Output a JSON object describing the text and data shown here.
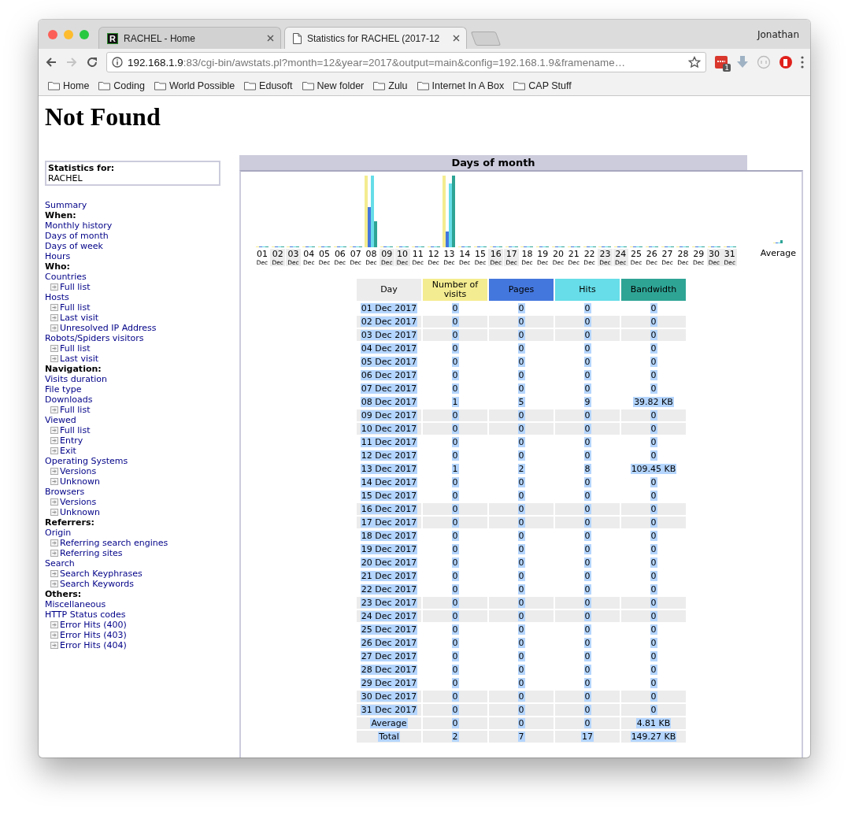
{
  "browser": {
    "tabs": [
      {
        "title": "RACHEL - Home",
        "selected": false,
        "kind": "logo",
        "logo_letter": "R"
      },
      {
        "title": "Statistics for RACHEL (2017-12",
        "selected": true,
        "kind": "page"
      }
    ],
    "profile": "Jonathan",
    "url": {
      "host": "192.168.1.9",
      "rest": ":83/cgi-bin/awstats.pl?month=12&year=2017&output=main&config=192.168.1.9&framename…"
    },
    "extension_badge": "1",
    "bookmarks": [
      "Home",
      "Coding",
      "World Possible",
      "Edusoft",
      "New folder",
      "Zulu",
      "Internet In A Box",
      "CAP Stuff"
    ]
  },
  "page": {
    "heading": "Not Found",
    "stats_for": {
      "label": "Statistics for:",
      "value": "RACHEL"
    },
    "menu": [
      {
        "kind": "link",
        "label": "Summary"
      },
      {
        "kind": "heading",
        "label": "When:"
      },
      {
        "kind": "link",
        "label": "Monthly history"
      },
      {
        "kind": "link",
        "label": "Days of month"
      },
      {
        "kind": "link",
        "label": "Days of week"
      },
      {
        "kind": "link",
        "label": "Hours"
      },
      {
        "kind": "heading",
        "label": "Who:"
      },
      {
        "kind": "link",
        "label": "Countries",
        "children": [
          {
            "label": "Full list"
          }
        ]
      },
      {
        "kind": "link",
        "label": "Hosts",
        "children": [
          {
            "label": "Full list"
          },
          {
            "label": "Last visit"
          },
          {
            "label": "Unresolved IP Address"
          }
        ]
      },
      {
        "kind": "link",
        "label": "Robots/Spiders visitors",
        "children": [
          {
            "label": "Full list"
          },
          {
            "label": "Last visit"
          }
        ]
      },
      {
        "kind": "heading",
        "label": "Navigation:"
      },
      {
        "kind": "link",
        "label": "Visits duration"
      },
      {
        "kind": "link",
        "label": "File type"
      },
      {
        "kind": "link",
        "label": "Downloads",
        "children": [
          {
            "label": "Full list"
          }
        ]
      },
      {
        "kind": "link",
        "label": "Viewed",
        "children": [
          {
            "label": "Full list"
          },
          {
            "label": "Entry"
          },
          {
            "label": "Exit"
          }
        ]
      },
      {
        "kind": "link",
        "label": "Operating Systems",
        "children": [
          {
            "label": "Versions"
          },
          {
            "label": "Unknown"
          }
        ]
      },
      {
        "kind": "link",
        "label": "Browsers",
        "children": [
          {
            "label": "Versions"
          },
          {
            "label": "Unknown"
          }
        ]
      },
      {
        "kind": "heading",
        "label": "Referrers:"
      },
      {
        "kind": "link",
        "label": "Origin",
        "children": [
          {
            "label": "Referring search engines"
          },
          {
            "label": "Referring sites"
          }
        ]
      },
      {
        "kind": "link",
        "label": "Search",
        "children": [
          {
            "label": "Search Keyphrases"
          },
          {
            "label": "Search Keywords"
          }
        ]
      },
      {
        "kind": "heading",
        "label": "Others:"
      },
      {
        "kind": "link",
        "label": "Miscellaneous"
      },
      {
        "kind": "link",
        "label": "HTTP Status codes",
        "children": [
          {
            "label": "Error Hits (400)"
          },
          {
            "label": "Error Hits (403)"
          },
          {
            "label": "Error Hits (404)"
          }
        ]
      }
    ],
    "section_title": "Days of month",
    "chart": {
      "average_label": "Average",
      "days": [
        {
          "day": "01",
          "month": "Dec",
          "weekend": false
        },
        {
          "day": "02",
          "month": "Dec",
          "weekend": true
        },
        {
          "day": "03",
          "month": "Dec",
          "weekend": true
        },
        {
          "day": "04",
          "month": "Dec",
          "weekend": false
        },
        {
          "day": "05",
          "month": "Dec",
          "weekend": false
        },
        {
          "day": "06",
          "month": "Dec",
          "weekend": false
        },
        {
          "day": "07",
          "month": "Dec",
          "weekend": false
        },
        {
          "day": "08",
          "month": "Dec",
          "weekend": false
        },
        {
          "day": "09",
          "month": "Dec",
          "weekend": true
        },
        {
          "day": "10",
          "month": "Dec",
          "weekend": true
        },
        {
          "day": "11",
          "month": "Dec",
          "weekend": false
        },
        {
          "day": "12",
          "month": "Dec",
          "weekend": false
        },
        {
          "day": "13",
          "month": "Dec",
          "weekend": false
        },
        {
          "day": "14",
          "month": "Dec",
          "weekend": false
        },
        {
          "day": "15",
          "month": "Dec",
          "weekend": false
        },
        {
          "day": "16",
          "month": "Dec",
          "weekend": true
        },
        {
          "day": "17",
          "month": "Dec",
          "weekend": true
        },
        {
          "day": "18",
          "month": "Dec",
          "weekend": false
        },
        {
          "day": "19",
          "month": "Dec",
          "weekend": false
        },
        {
          "day": "20",
          "month": "Dec",
          "weekend": false
        },
        {
          "day": "21",
          "month": "Dec",
          "weekend": false
        },
        {
          "day": "22",
          "month": "Dec",
          "weekend": false
        },
        {
          "day": "23",
          "month": "Dec",
          "weekend": true
        },
        {
          "day": "24",
          "month": "Dec",
          "weekend": true
        },
        {
          "day": "25",
          "month": "Dec",
          "weekend": false
        },
        {
          "day": "26",
          "month": "Dec",
          "weekend": false
        },
        {
          "day": "27",
          "month": "Dec",
          "weekend": false
        },
        {
          "day": "28",
          "month": "Dec",
          "weekend": false
        },
        {
          "day": "29",
          "month": "Dec",
          "weekend": false
        },
        {
          "day": "30",
          "month": "Dec",
          "weekend": true
        },
        {
          "day": "31",
          "month": "Dec",
          "weekend": true
        }
      ]
    },
    "table": {
      "text_selected": true,
      "columns": [
        {
          "label": "Day",
          "color": "#ececec"
        },
        {
          "label": "Number of visits",
          "color": "#f4ec90"
        },
        {
          "label": "Pages",
          "color": "#4477dd"
        },
        {
          "label": "Hits",
          "color": "#66dde8"
        },
        {
          "label": "Bandwidth",
          "color": "#2ea495"
        }
      ],
      "rows": [
        {
          "kind": "day",
          "weekend": false,
          "cells": [
            "01 Dec 2017",
            "0",
            "0",
            "0",
            "0"
          ]
        },
        {
          "kind": "day",
          "weekend": true,
          "cells": [
            "02 Dec 2017",
            "0",
            "0",
            "0",
            "0"
          ]
        },
        {
          "kind": "day",
          "weekend": true,
          "cells": [
            "03 Dec 2017",
            "0",
            "0",
            "0",
            "0"
          ]
        },
        {
          "kind": "day",
          "weekend": false,
          "cells": [
            "04 Dec 2017",
            "0",
            "0",
            "0",
            "0"
          ]
        },
        {
          "kind": "day",
          "weekend": false,
          "cells": [
            "05 Dec 2017",
            "0",
            "0",
            "0",
            "0"
          ]
        },
        {
          "kind": "day",
          "weekend": false,
          "cells": [
            "06 Dec 2017",
            "0",
            "0",
            "0",
            "0"
          ]
        },
        {
          "kind": "day",
          "weekend": false,
          "cells": [
            "07 Dec 2017",
            "0",
            "0",
            "0",
            "0"
          ]
        },
        {
          "kind": "day",
          "weekend": false,
          "cells": [
            "08 Dec 2017",
            "1",
            "5",
            "9",
            "39.82 KB"
          ]
        },
        {
          "kind": "day",
          "weekend": true,
          "cells": [
            "09 Dec 2017",
            "0",
            "0",
            "0",
            "0"
          ]
        },
        {
          "kind": "day",
          "weekend": true,
          "cells": [
            "10 Dec 2017",
            "0",
            "0",
            "0",
            "0"
          ]
        },
        {
          "kind": "day",
          "weekend": false,
          "cells": [
            "11 Dec 2017",
            "0",
            "0",
            "0",
            "0"
          ]
        },
        {
          "kind": "day",
          "weekend": false,
          "cells": [
            "12 Dec 2017",
            "0",
            "0",
            "0",
            "0"
          ]
        },
        {
          "kind": "day",
          "weekend": false,
          "cells": [
            "13 Dec 2017",
            "1",
            "2",
            "8",
            "109.45 KB"
          ]
        },
        {
          "kind": "day",
          "weekend": false,
          "cells": [
            "14 Dec 2017",
            "0",
            "0",
            "0",
            "0"
          ]
        },
        {
          "kind": "day",
          "weekend": false,
          "cells": [
            "15 Dec 2017",
            "0",
            "0",
            "0",
            "0"
          ]
        },
        {
          "kind": "day",
          "weekend": true,
          "cells": [
            "16 Dec 2017",
            "0",
            "0",
            "0",
            "0"
          ]
        },
        {
          "kind": "day",
          "weekend": true,
          "cells": [
            "17 Dec 2017",
            "0",
            "0",
            "0",
            "0"
          ]
        },
        {
          "kind": "day",
          "weekend": false,
          "cells": [
            "18 Dec 2017",
            "0",
            "0",
            "0",
            "0"
          ]
        },
        {
          "kind": "day",
          "weekend": false,
          "cells": [
            "19 Dec 2017",
            "0",
            "0",
            "0",
            "0"
          ]
        },
        {
          "kind": "day",
          "weekend": false,
          "cells": [
            "20 Dec 2017",
            "0",
            "0",
            "0",
            "0"
          ]
        },
        {
          "kind": "day",
          "weekend": false,
          "cells": [
            "21 Dec 2017",
            "0",
            "0",
            "0",
            "0"
          ]
        },
        {
          "kind": "day",
          "weekend": false,
          "cells": [
            "22 Dec 2017",
            "0",
            "0",
            "0",
            "0"
          ]
        },
        {
          "kind": "day",
          "weekend": true,
          "cells": [
            "23 Dec 2017",
            "0",
            "0",
            "0",
            "0"
          ]
        },
        {
          "kind": "day",
          "weekend": true,
          "cells": [
            "24 Dec 2017",
            "0",
            "0",
            "0",
            "0"
          ]
        },
        {
          "kind": "day",
          "weekend": false,
          "cells": [
            "25 Dec 2017",
            "0",
            "0",
            "0",
            "0"
          ]
        },
        {
          "kind": "day",
          "weekend": false,
          "cells": [
            "26 Dec 2017",
            "0",
            "0",
            "0",
            "0"
          ]
        },
        {
          "kind": "day",
          "weekend": false,
          "cells": [
            "27 Dec 2017",
            "0",
            "0",
            "0",
            "0"
          ]
        },
        {
          "kind": "day",
          "weekend": false,
          "cells": [
            "28 Dec 2017",
            "0",
            "0",
            "0",
            "0"
          ]
        },
        {
          "kind": "day",
          "weekend": false,
          "cells": [
            "29 Dec 2017",
            "0",
            "0",
            "0",
            "0"
          ]
        },
        {
          "kind": "day",
          "weekend": true,
          "cells": [
            "30 Dec 2017",
            "0",
            "0",
            "0",
            "0"
          ]
        },
        {
          "kind": "day",
          "weekend": true,
          "cells": [
            "31 Dec 2017",
            "0",
            "0",
            "0",
            "0"
          ]
        },
        {
          "kind": "average",
          "cells": [
            "Average",
            "0",
            "0",
            "0",
            "4.81 KB"
          ]
        },
        {
          "kind": "total",
          "cells": [
            "Total",
            "2",
            "7",
            "17",
            "149.27 KB"
          ]
        }
      ]
    }
  }
}
